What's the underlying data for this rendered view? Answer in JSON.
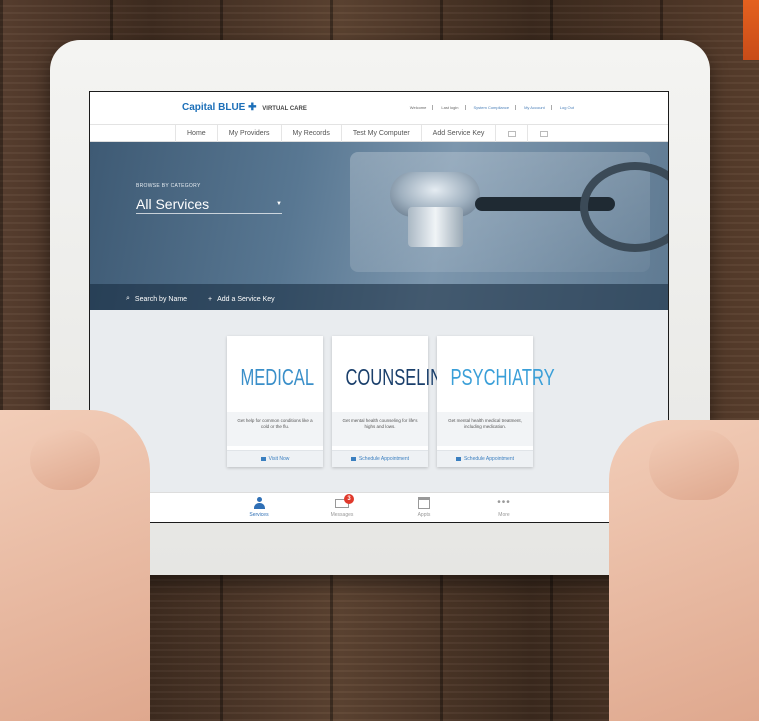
{
  "header": {
    "brand": "Capital BLUE",
    "brand_sub": "VIRTUAL CARE",
    "links": [
      "Welcome",
      "Last login",
      "System Compliance",
      "My Account",
      "Log Out"
    ]
  },
  "nav": {
    "items": [
      "Home",
      "My Providers",
      "My Records",
      "Test My Computer",
      "Add Service Key"
    ]
  },
  "hero": {
    "browse_label": "BROWSE BY CATEGORY",
    "category_value": "All Services",
    "search_label": "Search by Name",
    "add_key_label": "Add a Service Key"
  },
  "cards": [
    {
      "title": "MEDICAL",
      "description": "Get help for common conditions like a cold or the flu.",
      "action": "Visit Now",
      "color": "#3a8fc9"
    },
    {
      "title": "COUNSELING",
      "description": "Get mental health counseling for life's highs and lows.",
      "action": "Schedule Appointment",
      "color": "#1a3f6b"
    },
    {
      "title": "PSYCHIATRY",
      "description": "Get mental health medical treatment, including medication.",
      "action": "Schedule Appointment",
      "color": "#3a9fd8"
    }
  ],
  "tabbar": {
    "tabs": [
      {
        "label": "Services",
        "icon": "person-icon",
        "active": true
      },
      {
        "label": "Messages",
        "icon": "envelope-icon",
        "badge": "3"
      },
      {
        "label": "Appts",
        "icon": "calendar-icon"
      },
      {
        "label": "More",
        "icon": "more-icon"
      }
    ]
  }
}
